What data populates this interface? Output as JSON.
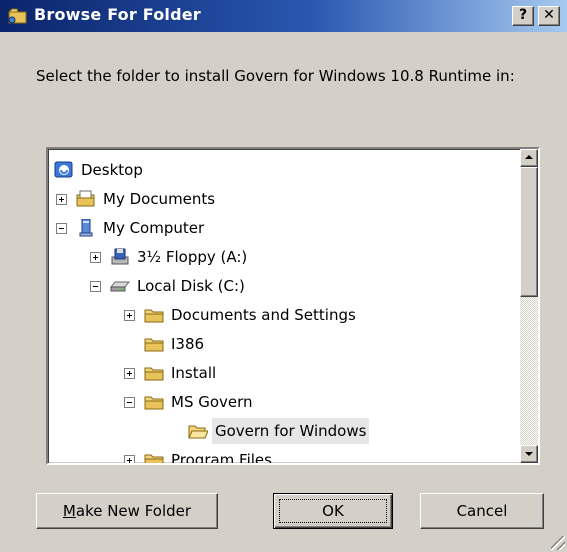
{
  "window": {
    "title": "Browse For Folder",
    "help_label": "?",
    "close_label": "✕"
  },
  "prompt": "Select the folder to install Govern for Windows 10.8 Runtime in:",
  "tree": {
    "items": [
      {
        "label": "Desktop",
        "icon": "desktop-icon",
        "expander": "none"
      },
      {
        "label": "My Documents",
        "icon": "folder-documents-icon",
        "expander": "plus"
      },
      {
        "label": "My Computer",
        "icon": "computer-icon",
        "expander": "minus"
      },
      {
        "label": "3½ Floppy (A:)",
        "icon": "floppy-drive-icon",
        "expander": "plus"
      },
      {
        "label": "Local Disk (C:)",
        "icon": "hard-disk-icon",
        "expander": "minus"
      },
      {
        "label": "Documents and Settings",
        "icon": "folder-icon",
        "expander": "plus"
      },
      {
        "label": "I386",
        "icon": "folder-icon",
        "expander": "none"
      },
      {
        "label": "Install",
        "icon": "folder-icon",
        "expander": "plus"
      },
      {
        "label": "MS Govern",
        "icon": "folder-icon",
        "expander": "minus"
      },
      {
        "label": "Govern for Windows",
        "icon": "folder-open-icon",
        "expander": "none",
        "selected": true
      },
      {
        "label": "Program Files",
        "icon": "folder-icon",
        "expander": "plus"
      }
    ]
  },
  "buttons": {
    "make_new_folder_mnemonic": "M",
    "make_new_folder_rest": "ake New Folder",
    "ok": "OK",
    "cancel": "Cancel"
  }
}
